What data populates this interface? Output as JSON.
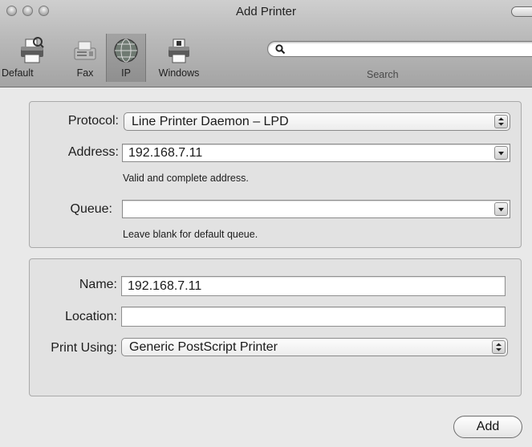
{
  "window": {
    "title": "Add Printer",
    "traffic_lights": [
      "close",
      "minimize",
      "zoom"
    ]
  },
  "toolbar": {
    "items": [
      {
        "label": "Default",
        "icon": "printer-icon",
        "selected": false
      },
      {
        "label": "Fax",
        "icon": "fax-icon",
        "selected": false
      },
      {
        "label": "IP",
        "icon": "globe-icon",
        "selected": true
      },
      {
        "label": "Windows",
        "icon": "windows-printer-icon",
        "selected": false
      }
    ],
    "search": {
      "value": "",
      "label": "Search",
      "icon": "magnifier-icon"
    }
  },
  "connection": {
    "protocol": {
      "label": "Protocol:",
      "value": "Line Printer Daemon – LPD"
    },
    "address": {
      "label": "Address:",
      "value": "192.168.7.11",
      "hint": "Valid and complete address."
    },
    "queue": {
      "label": "Queue:",
      "value": "",
      "hint": "Leave blank for default queue."
    }
  },
  "printer": {
    "name": {
      "label": "Name:",
      "value": "192.168.7.11"
    },
    "location": {
      "label": "Location:",
      "value": ""
    },
    "print_using": {
      "label": "Print Using:",
      "value": "Generic PostScript Printer"
    }
  },
  "footer": {
    "add_label": "Add"
  }
}
